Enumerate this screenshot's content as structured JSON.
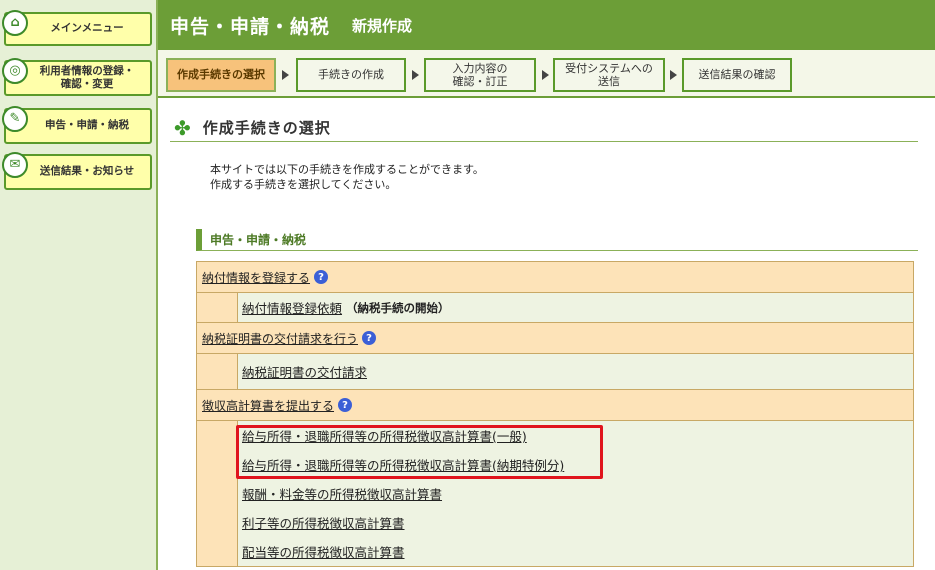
{
  "sidebar": {
    "items": [
      {
        "label": "メインメニュー",
        "icon": "home-icon"
      },
      {
        "label": "利用者情報の登録・\n確認・変更",
        "icon": "user-settings-icon"
      },
      {
        "label": "申告・申請・納税",
        "icon": "document-icon"
      },
      {
        "label": "送信結果・お知らせ",
        "icon": "mail-icon"
      }
    ]
  },
  "header": {
    "title": "申告・申請・納税",
    "subtitle": "新規作成"
  },
  "steps": [
    {
      "label": "作成手続きの選択",
      "active": true
    },
    {
      "label": "手続きの作成",
      "active": false
    },
    {
      "label": "入力内容の\n確認・訂正",
      "active": false
    },
    {
      "label": "受付システムへの\n送信",
      "active": false
    },
    {
      "label": "送信結果の確認",
      "active": false
    }
  ],
  "section": {
    "title": "作成手続きの選択",
    "intro_line1": "本サイトでは以下の手続きを作成することができます。",
    "intro_line2": "作成する手続きを選択してください。"
  },
  "category": {
    "title": "申告・申請・納税"
  },
  "groups": [
    {
      "title": "納付情報を登録する",
      "items": [
        {
          "label": "納付情報登録依頼",
          "note": "（納税手続の開始）"
        }
      ]
    },
    {
      "title": "納税証明書の交付請求を行う",
      "items": [
        {
          "label": "納税証明書の交付請求",
          "note": ""
        }
      ]
    },
    {
      "title": "徴収高計算書を提出する",
      "items": [
        {
          "label": "給与所得・退職所得等の所得税徴収高計算書(一般)",
          "note": ""
        },
        {
          "label": "給与所得・退職所得等の所得税徴収高計算書(納期特例分)",
          "note": ""
        },
        {
          "label": "報酬・料金等の所得税徴収高計算書",
          "note": ""
        },
        {
          "label": "利子等の所得税徴収高計算書",
          "note": ""
        },
        {
          "label": "配当等の所得税徴収高計算書",
          "note": ""
        }
      ]
    }
  ],
  "colors": {
    "header_green": "#6c9e37",
    "active_step": "#f7c27b",
    "table_head": "#fde3b8",
    "highlight_red": "#e0141d"
  }
}
